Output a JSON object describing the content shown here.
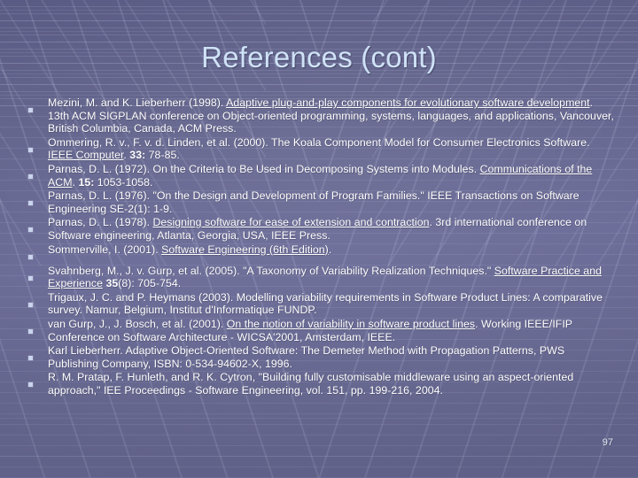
{
  "slide": {
    "title": "References (cont)",
    "page_number": "97",
    "bullet_glyph": "square-bullet",
    "colors": {
      "background_top": "#5b5c85",
      "background_mid": "#6d6e99",
      "background_bottom": "#65668f",
      "title_text": "#cfe2f7",
      "body_text": "#ffffff",
      "bullet": "#c9d4ee",
      "grid_line": "#d4d8f4"
    }
  },
  "references": [
    {
      "id": "ref-mezini-1998",
      "segments": [
        {
          "text": "Mezini, M. and K. Lieberherr (1998). ",
          "style": "normal"
        },
        {
          "text": "Adaptive plug-and-play components for evolutionary software development",
          "style": "underline"
        },
        {
          "text": ". 13th ACM SIGPLAN conference on Object-oriented programming, systems, languages, and applications, Vancouver, British Columbia, Canada, ACM Press.",
          "style": "normal"
        }
      ]
    },
    {
      "id": "ref-ommering-2000",
      "segments": [
        {
          "text": "Ommering, R. v., F. v. d. Linden, et al. (2000). The Koala Component Model for Consumer Electronics Software. ",
          "style": "normal"
        },
        {
          "text": "IEEE Computer",
          "style": "underline"
        },
        {
          "text": ". ",
          "style": "normal"
        },
        {
          "text": "33:",
          "style": "bold"
        },
        {
          "text": " 78-85.",
          "style": "normal"
        }
      ]
    },
    {
      "id": "ref-parnas-1972",
      "segments": [
        {
          "text": "Parnas, D. L. (1972). On the Criteria to Be Used in Decomposing Systems into Modules. ",
          "style": "normal"
        },
        {
          "text": "Communications of the ACM",
          "style": "underline"
        },
        {
          "text": ". ",
          "style": "normal"
        },
        {
          "text": "15:",
          "style": "bold"
        },
        {
          "text": " 1053-1058.",
          "style": "normal"
        }
      ]
    },
    {
      "id": "ref-parnas-1976",
      "segments": [
        {
          "text": "Parnas, D. L. (1976). \"On the Design and Development of Program Families.\" IEEE Transactions on Software Engineering SE-2(1): 1-9.",
          "style": "normal"
        }
      ]
    },
    {
      "id": "ref-parnas-1978",
      "segments": [
        {
          "text": "Parnas, D. L. (1978). ",
          "style": "normal"
        },
        {
          "text": "Designing software for ease of extension and contraction",
          "style": "underline"
        },
        {
          "text": ". 3rd international conference on Software engineering, Atlanta, Georgia, USA, IEEE Press.",
          "style": "normal"
        }
      ]
    },
    {
      "id": "ref-sommerville-2001",
      "segments": [
        {
          "text": "Sommerville, I. (2001). ",
          "style": "normal"
        },
        {
          "text": "Software Engineering (6th Edition)",
          "style": "underline"
        },
        {
          "text": ".",
          "style": "normal"
        }
      ]
    },
    {
      "id": "ref-svahnberg-2005",
      "segments": [
        {
          "text": "Svahnberg, M., J. v. Gurp, et al. (2005). \"A Taxonomy of Variability Realization Techniques.\" ",
          "style": "normal"
        },
        {
          "text": "Software Practice and Experience",
          "style": "underline"
        },
        {
          "text": " ",
          "style": "normal"
        },
        {
          "text": "35",
          "style": "bold"
        },
        {
          "text": "(8): 705-754.",
          "style": "normal"
        }
      ]
    },
    {
      "id": "ref-trigaux-2003",
      "segments": [
        {
          "text": "Trigaux, J. C. and P. Heymans (2003). Modelling variability requirements in Software Product Lines: A comparative survey. Namur, Belgium, Institut d'Informatique FUNDP.",
          "style": "normal"
        }
      ]
    },
    {
      "id": "ref-vangurp-2001",
      "segments": [
        {
          "text": "van Gurp, J., J. Bosch, et al. (2001). ",
          "style": "normal"
        },
        {
          "text": "On the notion of variability in software product lines",
          "style": "underline"
        },
        {
          "text": ". Working IEEE/IFIP Conference on Software Architecture - WICSA'2001, Amsterdam, IEEE.",
          "style": "normal"
        }
      ]
    },
    {
      "id": "ref-lieberherr-1996",
      "segments": [
        {
          "text": "Karl Lieberherr. Adaptive Object-Oriented Software: The Demeter Method with Propagation Patterns, PWS Publishing Company, ISBN: 0-534-94602-X, 1996.",
          "style": "normal"
        }
      ]
    },
    {
      "id": "ref-pratap-2004",
      "segments": [
        {
          "text": "R. M. Pratap, F. Hunleth, and R. K. Cytron, \"Building fully customisable middleware using an aspect-oriented approach,\" IEE Proceedings - Software Engineering, vol. 151, pp. 199-216, 2004.",
          "style": "normal"
        }
      ]
    }
  ]
}
